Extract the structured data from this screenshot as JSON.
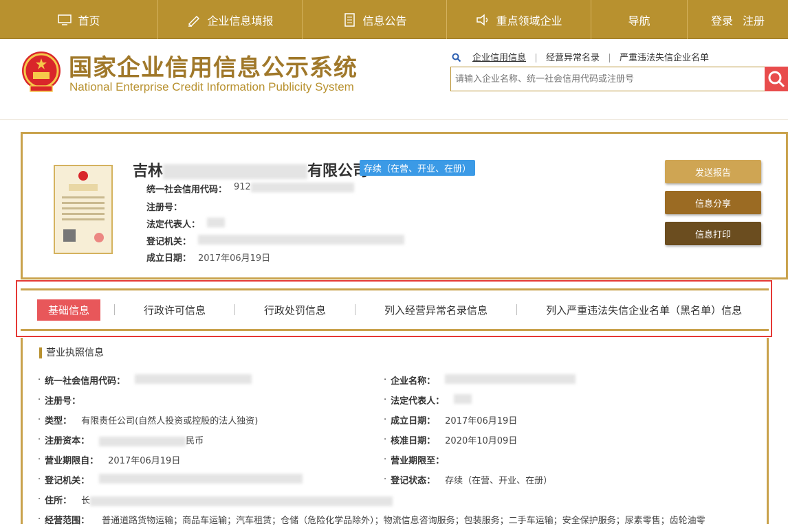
{
  "topnav": {
    "items": [
      {
        "label": "首页",
        "icon": "monitor-icon"
      },
      {
        "label": "企业信息填报",
        "icon": "pen-icon"
      },
      {
        "label": "信息公告",
        "icon": "document-icon"
      },
      {
        "label": "重点领域企业",
        "icon": "speaker-icon"
      },
      {
        "label": "导航",
        "icon": ""
      }
    ],
    "login": "登录",
    "register": "注册"
  },
  "header": {
    "title_cn": "国家企业信用信息公示系统",
    "title_en": "National Enterprise Credit Information Publicity System",
    "search_tabs": [
      "企业信用信息",
      "经营异常名录",
      "严重违法失信企业名单"
    ],
    "search_placeholder": "请输入企业名称、统一社会信用代码或注册号"
  },
  "company": {
    "name_start": "吉林",
    "name_end": "有限公司",
    "status": "存续（在营、开业、在册）",
    "credit_code_label": "统一社会信用代码：",
    "credit_code_prefix": "912",
    "reg_no_label": "注册号：",
    "legal_rep_label": "法定代表人：",
    "authority_label": "登记机关：",
    "established_label": "成立日期：",
    "established_value": "2017年06月19日",
    "buttons": {
      "send": "发送报告",
      "share": "信息分享",
      "print": "信息打印"
    }
  },
  "tabs": [
    "基础信息",
    "行政许可信息",
    "行政处罚信息",
    "列入经营异常名录信息",
    "列入严重违法失信企业名单（黑名单）信息"
  ],
  "details": {
    "section_title": "营业执照信息",
    "left": [
      {
        "label": "统一社会信用代码：",
        "value": ""
      },
      {
        "label": "注册号：",
        "value": ""
      },
      {
        "label": "类型：",
        "value": "有限责任公司(自然人投资或控股的法人独资)"
      },
      {
        "label": "注册资本：",
        "value": "民币"
      },
      {
        "label": "营业期限自：",
        "value": "2017年06月19日"
      },
      {
        "label": "登记机关：",
        "value": ""
      },
      {
        "label": "住所：",
        "value": "长"
      },
      {
        "label": "经营范围：",
        "value": "普通道路货物运输；商品车运输；汽车租赁；仓储（危险化学品除外）；物流信息咨询服务；包装服务；二手车运输；安全保护服务；尿素零售；齿轮油零"
      }
    ],
    "right": [
      {
        "label": "企业名称：",
        "value": ""
      },
      {
        "label": "法定代表人：",
        "value": ""
      },
      {
        "label": "成立日期：",
        "value": "2017年06月19日"
      },
      {
        "label": "核准日期：",
        "value": "2020年10月09日"
      },
      {
        "label": "营业期限至：",
        "value": ""
      },
      {
        "label": "登记状态：",
        "value": "存续（在营、开业、在册）"
      }
    ]
  }
}
